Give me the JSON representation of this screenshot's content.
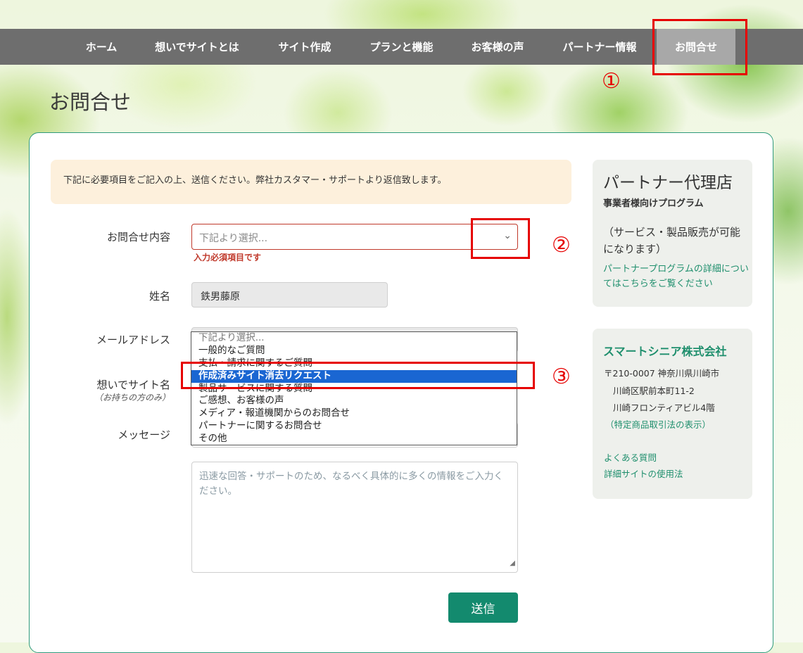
{
  "nav": {
    "items": [
      {
        "label": "ホーム"
      },
      {
        "label": "想いでサイトとは"
      },
      {
        "label": "サイト作成"
      },
      {
        "label": "プランと機能"
      },
      {
        "label": "お客様の声"
      },
      {
        "label": "パートナー情報"
      },
      {
        "label": "お問合せ",
        "active": true
      }
    ]
  },
  "annotations": {
    "one": "①",
    "two": "②",
    "three": "③",
    "color": "#e60000"
  },
  "page": {
    "title": "お問合せ"
  },
  "notice": "下記に必要項目をご記入の上、送信ください。弊社カスタマー・サポートより返信致します。",
  "form": {
    "inquiry_label": "お問合せ内容",
    "inquiry_placeholder": "下記より選択...",
    "required_error": "入力必須項目です",
    "name_label": "姓名",
    "name_value": "鉄男藤原",
    "email_label": "メールアドレス",
    "site_label": "想いでサイト名",
    "site_sublabel": "（お持ちの方のみ）",
    "message_label": "メッセージ",
    "message_placeholder": "迅速な回答・サポートのため、なるべく具体的に多くの情報をご入力ください。",
    "submit_label": "送信",
    "options": [
      "下記より選択...",
      "一般的なご質問",
      "支払・請求に関するご質問",
      "作成済みサイト消去リクエスト",
      "製品サービスに関する質問",
      "ご感想、お客様の声",
      "メディア・報道機関からのお問合せ",
      "パートナーに関するお問合せ",
      "その他"
    ],
    "highlighted_option": "作成済みサイト消去リクエスト"
  },
  "sidebar": {
    "partner": {
      "title": "パートナー代理店",
      "subtitle": "事業者様向けプログラム",
      "description": "（サービス・製品販売が可能になります）",
      "link": "パートナープログラムの詳細についてはこちらをご覧ください"
    },
    "company": {
      "name": "スマートシニア株式会社",
      "address_line1": "〒210-0007 神奈川県川崎市",
      "address_line2": "川崎区駅前本町11-2",
      "address_line3": "川崎フロンティアビル4階",
      "legal_link": "（特定商品取引法の表示）",
      "faq_link": "よくある質問",
      "usage_link": "詳細サイトの使用法"
    }
  },
  "colors": {
    "nav_bg": "#6e6e6e",
    "nav_active": "#a8a8a8",
    "accent_green": "#138a6e",
    "error_red": "#c0392b",
    "selected_blue": "#1a66d2"
  }
}
